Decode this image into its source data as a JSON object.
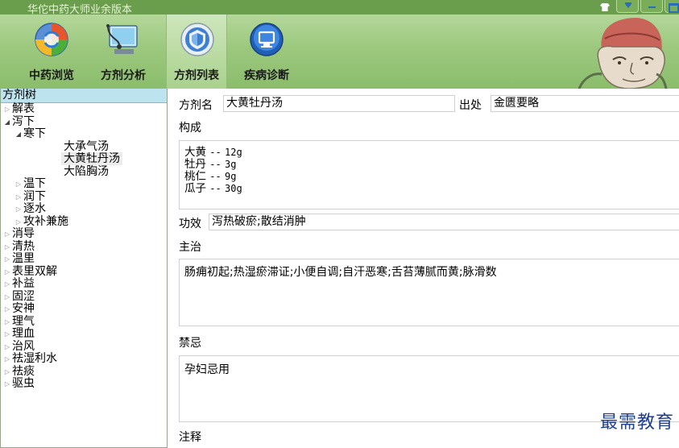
{
  "window": {
    "title": "华佗中药大师业余版本"
  },
  "toolbar": {
    "tools": [
      {
        "label": "中药浏览",
        "icon": "herb-browse-icon"
      },
      {
        "label": "方剂分析",
        "icon": "prescription-analysis-icon"
      },
      {
        "label": "方剂列表",
        "icon": "prescription-list-icon",
        "active": true
      },
      {
        "label": "疾病诊断",
        "icon": "disease-diagnosis-icon"
      }
    ]
  },
  "sidebar": {
    "header": "方剂树",
    "tree": [
      {
        "label": "解表",
        "level": 0,
        "expanded": false
      },
      {
        "label": "泻下",
        "level": 0,
        "expanded": true
      },
      {
        "label": "寒下",
        "level": 1,
        "expanded": true
      },
      {
        "label": "大承气汤",
        "level": 2,
        "leaf": true
      },
      {
        "label": "大黄牡丹汤",
        "level": 2,
        "leaf": true,
        "selected": true
      },
      {
        "label": "大陷胸汤",
        "level": 2,
        "leaf": true
      },
      {
        "label": "温下",
        "level": 1,
        "expanded": false
      },
      {
        "label": "润下",
        "level": 1,
        "expanded": false
      },
      {
        "label": "逐水",
        "level": 1,
        "expanded": false
      },
      {
        "label": "攻补兼施",
        "level": 1,
        "expanded": false
      },
      {
        "label": "消导",
        "level": 0,
        "expanded": false
      },
      {
        "label": "清热",
        "level": 0,
        "expanded": false
      },
      {
        "label": "温里",
        "level": 0,
        "expanded": false
      },
      {
        "label": "表里双解",
        "level": 0,
        "expanded": false
      },
      {
        "label": "补益",
        "level": 0,
        "expanded": false
      },
      {
        "label": "固涩",
        "level": 0,
        "expanded": false
      },
      {
        "label": "安神",
        "level": 0,
        "expanded": false
      },
      {
        "label": "理气",
        "level": 0,
        "expanded": false
      },
      {
        "label": "理血",
        "level": 0,
        "expanded": false
      },
      {
        "label": "治风",
        "level": 0,
        "expanded": false
      },
      {
        "label": "祛湿利水",
        "level": 0,
        "expanded": false
      },
      {
        "label": "祛痰",
        "level": 0,
        "expanded": false
      },
      {
        "label": "驱虫",
        "level": 0,
        "expanded": false
      }
    ]
  },
  "detail": {
    "name_label": "方剂名",
    "name_value": "大黄牡丹汤",
    "source_label": "出处",
    "source_value": "金匮要略",
    "composition_label": "构成",
    "composition": [
      {
        "herb": "大黄",
        "sep": "--",
        "amount": "12g"
      },
      {
        "herb": "牡丹",
        "sep": "--",
        "amount": "3g"
      },
      {
        "herb": "桃仁",
        "sep": "--",
        "amount": "9g"
      },
      {
        "herb": "瓜子",
        "sep": "--",
        "amount": "30g"
      }
    ],
    "efficacy_label": "功效",
    "efficacy_value": "泻热破瘀;散结消肿",
    "indication_label": "主治",
    "indication_value": "肠痈初起;热湿瘀滞证;小便自调;自汗恶寒;舌苔薄腻而黄;脉滑数",
    "contraindication_label": "禁忌",
    "contraindication_value": "孕妇忌用",
    "notes_label": "注释"
  },
  "watermark": "最需教育"
}
